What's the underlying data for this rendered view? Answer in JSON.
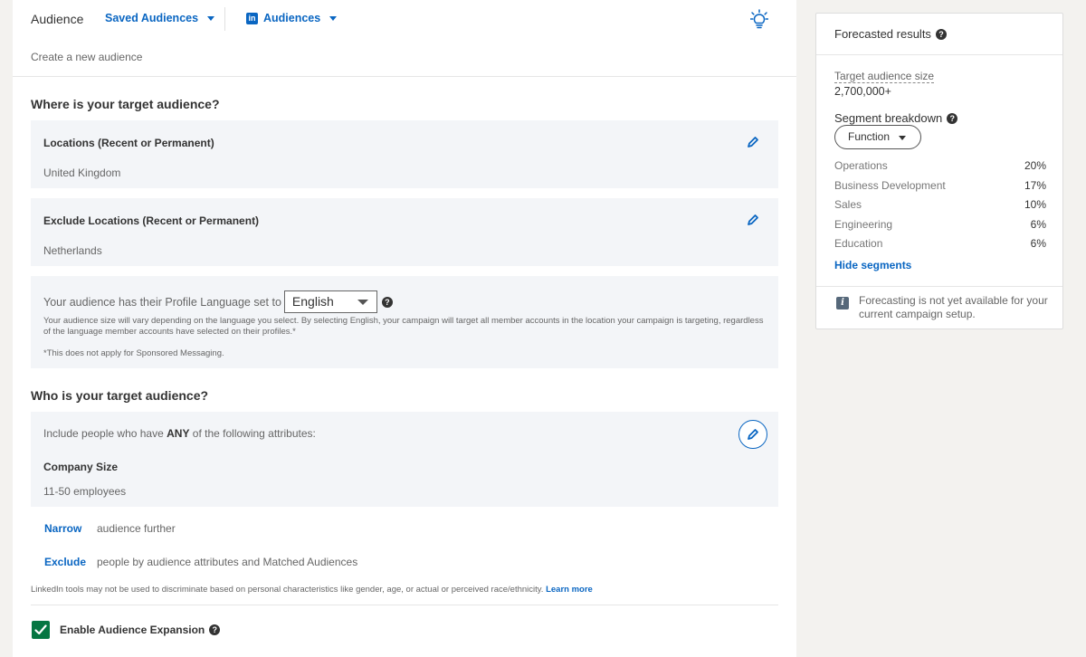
{
  "header": {
    "title": "Audience",
    "saved_audiences": "Saved Audiences",
    "audiences": "Audiences",
    "subtitle": "Create a new audience",
    "icons": {
      "linkedin": "linkedin-logo-icon",
      "bulb": "lightbulb-icon"
    }
  },
  "where": {
    "title": "Where is your target audience?",
    "locations": {
      "label": "Locations (Recent or Permanent)",
      "value": "United Kingdom"
    },
    "exclude": {
      "label": "Exclude Locations (Recent or Permanent)",
      "value": "Netherlands"
    },
    "language": {
      "prefix": "Your audience has their Profile Language set to",
      "selected": "English",
      "note": "Your audience size will vary depending on the language you select. By selecting English, your campaign will target all member accounts in the location your campaign is targeting, regardless of the language member accounts have selected on their profiles.*",
      "footnote": "*This does not apply for Sponsored Messaging."
    }
  },
  "who": {
    "title": "Who is your target audience?",
    "include_prefix": "Include people who have ",
    "include_any": "ANY",
    "include_suffix": " of the following attributes:",
    "attribute_label": "Company Size",
    "attribute_value": "11-50 employees",
    "narrow_link": "Narrow",
    "narrow_text": "audience further",
    "exclude_link": "Exclude",
    "exclude_text": "people by audience attributes and Matched Audiences"
  },
  "legal": {
    "text": "LinkedIn tools may not be used to discriminate based on personal characteristics like gender, age, or actual or perceived race/ethnicity.",
    "link": "Learn more"
  },
  "expansion": {
    "label": "Enable Audience Expansion",
    "checked": true
  },
  "forecast": {
    "title": "Forecasted results",
    "size_label": "Target audience size",
    "size_value": "2,700,000+",
    "segment_title": "Segment breakdown",
    "segment_filter": "Function",
    "segments": [
      {
        "name": "Operations",
        "value": "20%"
      },
      {
        "name": "Business Development",
        "value": "17%"
      },
      {
        "name": "Sales",
        "value": "10%"
      },
      {
        "name": "Engineering",
        "value": "6%"
      },
      {
        "name": "Education",
        "value": "6%"
      }
    ],
    "hide_link": "Hide segments",
    "info": "Forecasting is not yet available for your current campaign setup.",
    "info_icon": "info-icon"
  },
  "colors": {
    "accent": "#0a66c2",
    "check": "#057642",
    "card": "#f3f5f8"
  }
}
